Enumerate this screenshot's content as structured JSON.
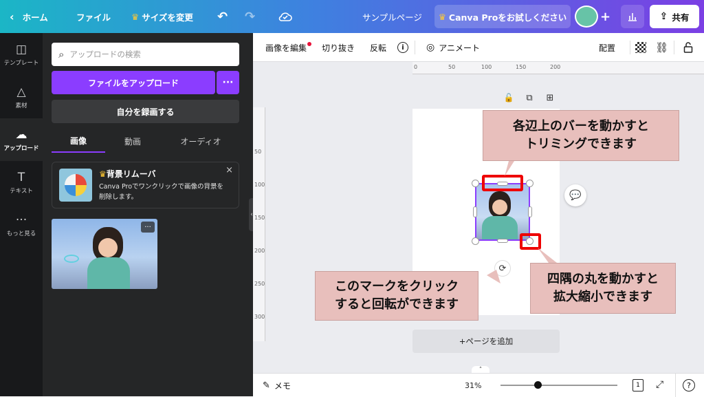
{
  "topbar": {
    "back_label": "ホーム",
    "file_label": "ファイル",
    "resize_label": "サイズを変更",
    "title": "サンプルページ",
    "pro_trial": "Canva Proをお試しください",
    "share": "共有"
  },
  "rail": {
    "items": [
      {
        "label": "テンプレート",
        "icon": "layout-icon"
      },
      {
        "label": "素材",
        "icon": "shapes-icon"
      },
      {
        "label": "アップロード",
        "icon": "upload-cloud-icon"
      },
      {
        "label": "テキスト",
        "icon": "text-icon"
      },
      {
        "label": "もっと見る",
        "icon": "more-dots-icon"
      }
    ]
  },
  "panel": {
    "search_placeholder": "アップロードの検索",
    "upload_button": "ファイルをアップロード",
    "more_button": "···",
    "record_button": "自分を録画する",
    "tabs": [
      "画像",
      "動画",
      "オーディオ"
    ],
    "promo_title": "背景リムーバ",
    "promo_body": "Canva Proでワンクリックで画像の背景を削除します。",
    "thumb_more": "···"
  },
  "toolbar": {
    "edit_image": "画像を編集",
    "crop": "切り抜き",
    "flip": "反転",
    "animate": "アニメート",
    "position": "配置"
  },
  "ruler": {
    "h_ticks": [
      "0",
      "50",
      "100",
      "150",
      "200"
    ],
    "v_ticks": [
      "50",
      "100",
      "150",
      "200",
      "250",
      "300"
    ]
  },
  "canvas": {
    "add_page": "+ページを追加"
  },
  "callouts": {
    "trim": "各辺上のバーを動かすと\nトリミングできます",
    "rotate": "このマークをクリック\nすると回転ができます",
    "resize": "四隅の丸を動かすと\n拡大縮小できます"
  },
  "footer": {
    "notes": "メモ",
    "zoom": "31%",
    "page_count": "1",
    "help": "?",
    "zoom_level": 0.32
  },
  "colors": {
    "accent": "#8b3dff",
    "callout_bg": "#e8bfbc",
    "highlight": "#e00000"
  }
}
